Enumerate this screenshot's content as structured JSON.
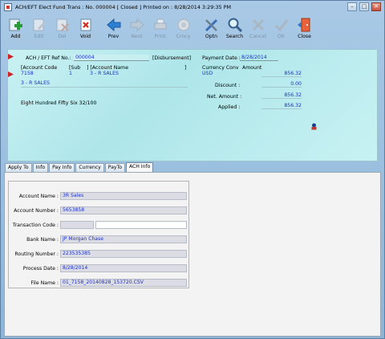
{
  "window": {
    "title": "ACH/EFT Elect Fund Trans : No. 000004    [ Closed ]  Printed on : 8/28/2014 3:29:35 PM",
    "min": "–",
    "max": "□",
    "close": "✕"
  },
  "toolbar": [
    {
      "label": "Add",
      "icon": "add-icon",
      "enabled": true
    },
    {
      "label": "Edit",
      "icon": "edit-icon",
      "enabled": false
    },
    {
      "label": "Del",
      "icon": "delete-icon",
      "enabled": false
    },
    {
      "label": "Void",
      "icon": "void-icon",
      "enabled": true
    },
    {
      "label": "Prev",
      "icon": "prev-icon",
      "enabled": true
    },
    {
      "label": "Next",
      "icon": "next-icon",
      "enabled": false
    },
    {
      "label": "Print",
      "icon": "print-icon",
      "enabled": false
    },
    {
      "label": "Crncy",
      "icon": "currency-icon",
      "enabled": false
    },
    {
      "label": "Optn",
      "icon": "options-icon",
      "enabled": true
    },
    {
      "label": "Search",
      "icon": "search-icon",
      "enabled": true
    },
    {
      "label": "Cancel",
      "icon": "cancel-icon",
      "enabled": false
    },
    {
      "label": "OK",
      "icon": "ok-icon",
      "enabled": false
    },
    {
      "label": "Close",
      "icon": "close-door-icon",
      "enabled": true
    }
  ],
  "header": {
    "ref_label": "ACH / EFT Ref No.:",
    "ref_value": "000004",
    "ref_type": "[Disbursement]",
    "payment_date_label": "Payment Date :",
    "payment_date_value": "8/28/2014",
    "col_account_code": "[Account Code",
    "col_sub": "[Sub",
    "col_account_name": "] [Account Name",
    "col_end": "]",
    "account_code": "7158",
    "sub": "1",
    "account_name": "3 - R SALES",
    "currency_conv_label": "Currency Conv",
    "amount_label": "Amount",
    "currency": "USD",
    "amount": "856.32",
    "payee": "3 - R SALES",
    "discount_label": "Discount :",
    "discount": "0.00",
    "net_amount_label": "Net. Amount :",
    "net_amount": "856.32",
    "amount_words": "Eight Hundred Fifty Six 32/100",
    "applied_label": "Applied :",
    "applied": "856.32"
  },
  "tabs": [
    "Apply To",
    "Info",
    "Pay Info",
    "Currency",
    "PayTo",
    "ACH Info"
  ],
  "active_tab": "ACH Info",
  "ach": {
    "account_name_label": "Account Name :",
    "account_name": "3R Sales",
    "account_number_label": "Account Number :",
    "account_number": "5653858",
    "transaction_code_label": "Transaction Code :",
    "transaction_code": "",
    "bank_name_label": "Bank Name :",
    "bank_name": "JP Morgan Chase",
    "routing_number_label": "Routing Number :",
    "routing_number": "223535385",
    "process_date_label": "Process Date :",
    "process_date": "8/28/2014",
    "file_name_label": "File Name :",
    "file_name": "01_7158_20140828_153720.CSV"
  }
}
